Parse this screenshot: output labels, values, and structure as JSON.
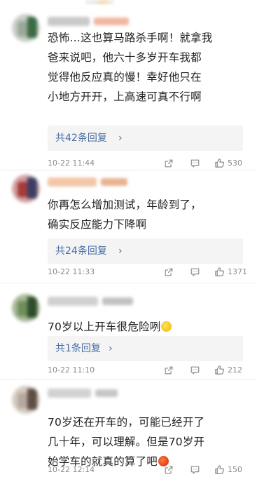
{
  "comments": [
    {
      "text": "恐怖…这也算马路杀手啊！就拿我\n爸来说吧，他六十多岁开车我都\n觉得他反应真的慢！幸好他只在\n小地方开开，上高速可真不行啊",
      "emoji": "",
      "replies_label": "共42条回复",
      "replies_chevron": "›",
      "timestamp": "10-22 11:44",
      "likes": "530",
      "avatar_colors": [
        "#9aa89a",
        "#3d6b45",
        "#c8cfc6"
      ],
      "name_colors": [
        "#c9c9c9",
        "#f0b7a0"
      ]
    },
    {
      "text": "你再怎么增加测试，年龄到了，\n确实反应能力下降啊",
      "emoji": "",
      "replies_label": "共24条回复",
      "replies_chevron": "›",
      "timestamp": "10-22 11:33",
      "likes": "1371",
      "avatar_colors": [
        "#a83a3a",
        "#3a3f66",
        "#d2a0a0"
      ],
      "name_colors": [
        "#f2c7a8",
        "#e8b291"
      ]
    },
    {
      "text": "70岁以上开车很危险咧",
      "emoji": "sweat-smile-emoji",
      "replies_label": "共1条回复",
      "replies_chevron": "›",
      "timestamp": "10-22 11:10",
      "likes": "212",
      "avatar_colors": [
        "#6f8f5a",
        "#2f4d2a",
        "#a9b89a"
      ],
      "name_colors": [
        "#d0d0d0",
        "#c2c2c2"
      ]
    },
    {
      "text": "70岁还在开车的，可能已经开了\n几十年，可以理解。但是70岁开\n始学车的就真的算了吧",
      "emoji": "angry-face-emoji",
      "replies_label": "",
      "replies_chevron": "",
      "timestamp": "10-22 12:14",
      "likes": "150",
      "avatar_colors": [
        "#b6aaa0",
        "#5e4d44",
        "#d6cbc2"
      ],
      "name_colors": [
        "#d2d2d2",
        "#c6c6c6"
      ]
    }
  ],
  "icons": {
    "share": "share-icon",
    "comment": "comment-icon",
    "like": "thumbs-up-icon"
  },
  "colors": {
    "link": "#4a6ea5",
    "reply_bg": "#f4f4f4",
    "meta": "#8a8a8a"
  }
}
